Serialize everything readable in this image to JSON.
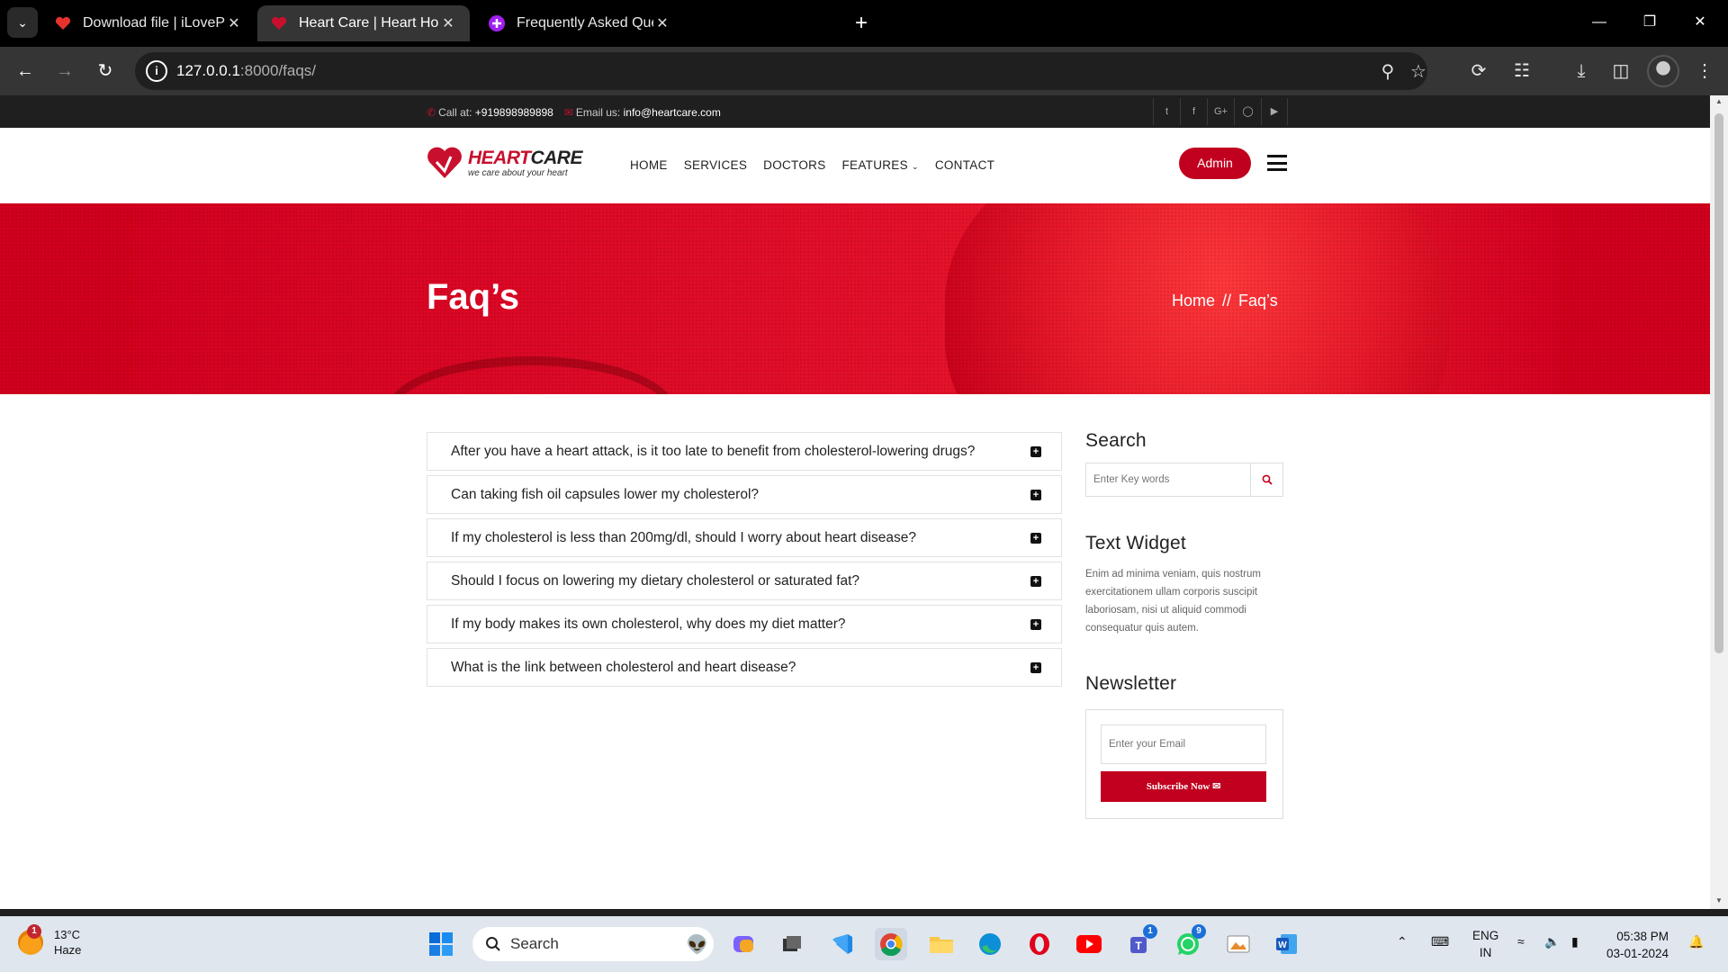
{
  "browser": {
    "tabs": [
      {
        "title": "Download file | iLovePDF",
        "active": false
      },
      {
        "title": "Heart Care | Heart Hospital",
        "active": true
      },
      {
        "title": "Frequently Asked Questions Ab",
        "active": false
      }
    ],
    "url_host": "127.0.0.1",
    "url_rest": ":8000/faqs/"
  },
  "site": {
    "topbar": {
      "call_label": "Call at:",
      "phone": "+919898989898",
      "email_label": "Email us:",
      "email": "info@heartcare.com",
      "social_icons": [
        "twitter-icon",
        "facebook-icon",
        "google-plus-icon",
        "instagram-icon",
        "youtube-icon"
      ]
    },
    "logo": {
      "name_red": "HEART",
      "name_dark": "CARE",
      "tagline": "we care about your heart"
    },
    "menu": [
      "HOME",
      "SERVICES",
      "DOCTORS",
      "FEATURES",
      "CONTACT"
    ],
    "admin_label": "Admin",
    "banner": {
      "title": "Faq’s",
      "crumb_home": "Home",
      "crumb_sep": "//",
      "crumb_current": "Faq’s"
    },
    "faqs": [
      "After you have a heart attack, is it too late to benefit from cholesterol-lowering drugs?",
      "Can taking fish oil capsules lower my cholesterol?",
      "If my cholesterol is less than 200mg/dl, should I worry about heart disease?",
      "Should I focus on lowering my dietary cholesterol or saturated fat?",
      "If my body makes its own cholesterol, why does my diet matter?",
      "What is the link between cholesterol and heart disease?"
    ],
    "sidebar": {
      "search_title": "Search",
      "search_placeholder": "Enter Key words",
      "text_widget_title": "Text Widget",
      "text_widget_body": "Enim ad minima veniam, quis nostrum exercitationem ullam corporis suscipit laboriosam, nisi ut aliquid commodi consequatur quis autem.",
      "newsletter_title": "Newsletter",
      "newsletter_placeholder": "Enter your Email",
      "subscribe_label": "Subscribe Now"
    },
    "colors": {
      "brand": "#c1001f",
      "topbar": "#1f1f1f"
    }
  },
  "taskbar": {
    "weather_temp": "13°C",
    "weather_desc": "Haze",
    "weather_badge": "1",
    "search_label": "Search",
    "teams_badge": "1",
    "whatsapp_badge": "9",
    "lang_1": "ENG",
    "lang_2": "IN",
    "time": "05:38 PM",
    "date": "03-01-2024"
  }
}
